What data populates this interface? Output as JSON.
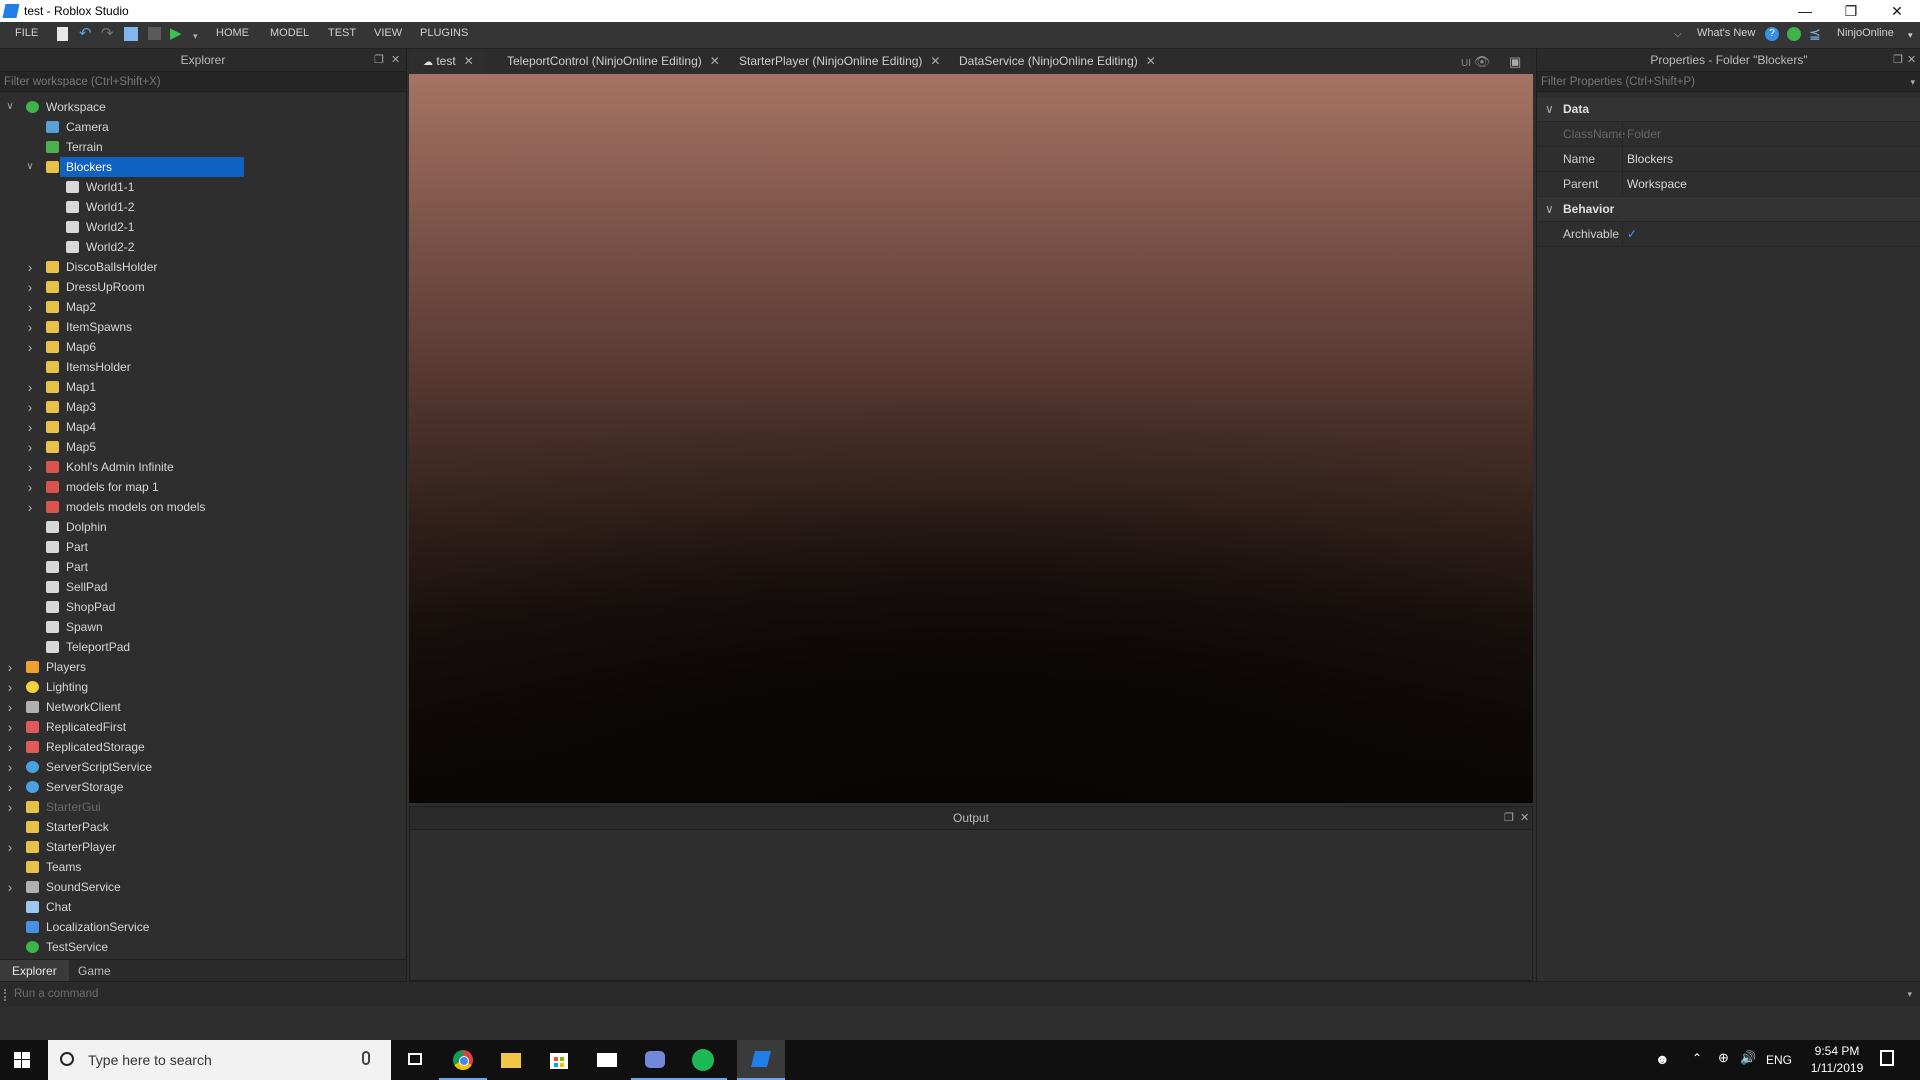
{
  "window": {
    "title": "test - Roblox Studio"
  },
  "menu": [
    "FILE",
    "HOME",
    "MODEL",
    "TEST",
    "VIEW",
    "PLUGINS"
  ],
  "header_right": {
    "whats_new": "What's New",
    "user": "NinjoOnline"
  },
  "explorer": {
    "title": "Explorer",
    "filter_placeholder": "Filter workspace (Ctrl+Shift+X)",
    "rows": [
      {
        "label": "Workspace",
        "depth": 0,
        "chev": "down",
        "icon": "globe",
        "color": "#3db34a"
      },
      {
        "label": "Camera",
        "depth": 1,
        "chev": "",
        "icon": "camera",
        "color": "#5aa0d8"
      },
      {
        "label": "Terrain",
        "depth": 1,
        "chev": "",
        "icon": "terrain",
        "color": "#4caf50"
      },
      {
        "label": "Blockers",
        "depth": 1,
        "chev": "down",
        "icon": "folder",
        "color": "#e8c148",
        "selected": true
      },
      {
        "label": "World1-1",
        "depth": 2,
        "chev": "",
        "icon": "part",
        "color": "#d8d8d8"
      },
      {
        "label": "World1-2",
        "depth": 2,
        "chev": "",
        "icon": "part",
        "color": "#d8d8d8"
      },
      {
        "label": "World2-1",
        "depth": 2,
        "chev": "",
        "icon": "part",
        "color": "#d8d8d8"
      },
      {
        "label": "World2-2",
        "depth": 2,
        "chev": "",
        "icon": "part",
        "color": "#d8d8d8"
      },
      {
        "label": "DiscoBallsHolder",
        "depth": 1,
        "chev": "right",
        "icon": "folder",
        "color": "#e8c148"
      },
      {
        "label": "DressUpRoom",
        "depth": 1,
        "chev": "right",
        "icon": "folder",
        "color": "#e8c148"
      },
      {
        "label": "Map2",
        "depth": 1,
        "chev": "right",
        "icon": "folder",
        "color": "#e8c148"
      },
      {
        "label": "ItemSpawns",
        "depth": 1,
        "chev": "right",
        "icon": "folder",
        "color": "#e8c148"
      },
      {
        "label": "Map6",
        "depth": 1,
        "chev": "right",
        "icon": "folder",
        "color": "#e8c148"
      },
      {
        "label": "ItemsHolder",
        "depth": 1,
        "chev": "",
        "icon": "folder",
        "color": "#e8c148"
      },
      {
        "label": "Map1",
        "depth": 1,
        "chev": "right",
        "icon": "folder",
        "color": "#e8c148"
      },
      {
        "label": "Map3",
        "depth": 1,
        "chev": "right",
        "icon": "folder",
        "color": "#e8c148"
      },
      {
        "label": "Map4",
        "depth": 1,
        "chev": "right",
        "icon": "folder",
        "color": "#e8c148"
      },
      {
        "label": "Map5",
        "depth": 1,
        "chev": "right",
        "icon": "folder",
        "color": "#e8c148"
      },
      {
        "label": "Kohl's Admin Infinite",
        "depth": 1,
        "chev": "right",
        "icon": "model",
        "color": "#d9534f"
      },
      {
        "label": "models for map 1",
        "depth": 1,
        "chev": "right",
        "icon": "model",
        "color": "#d9534f"
      },
      {
        "label": "models models on models",
        "depth": 1,
        "chev": "right",
        "icon": "model",
        "color": "#d9534f"
      },
      {
        "label": "Dolphin",
        "depth": 1,
        "chev": "",
        "icon": "part",
        "color": "#d8d8d8"
      },
      {
        "label": "Part",
        "depth": 1,
        "chev": "",
        "icon": "part",
        "color": "#d8d8d8"
      },
      {
        "label": "Part",
        "depth": 1,
        "chev": "",
        "icon": "part",
        "color": "#d8d8d8"
      },
      {
        "label": "SellPad",
        "depth": 1,
        "chev": "",
        "icon": "part",
        "color": "#d8d8d8"
      },
      {
        "label": "ShopPad",
        "depth": 1,
        "chev": "",
        "icon": "part",
        "color": "#d8d8d8"
      },
      {
        "label": "Spawn",
        "depth": 1,
        "chev": "",
        "icon": "part",
        "color": "#d8d8d8"
      },
      {
        "label": "TeleportPad",
        "depth": 1,
        "chev": "",
        "icon": "part",
        "color": "#d8d8d8"
      },
      {
        "label": "Players",
        "depth": 0,
        "chev": "right",
        "icon": "players",
        "color": "#f0a030"
      },
      {
        "label": "Lighting",
        "depth": 0,
        "chev": "right",
        "icon": "lighting",
        "color": "#f3d23f"
      },
      {
        "label": "NetworkClient",
        "depth": 0,
        "chev": "right",
        "icon": "network",
        "color": "#b0b0b0"
      },
      {
        "label": "ReplicatedFirst",
        "depth": 0,
        "chev": "right",
        "icon": "replicated",
        "color": "#e05a5a"
      },
      {
        "label": "ReplicatedStorage",
        "depth": 0,
        "chev": "right",
        "icon": "replicated",
        "color": "#e05a5a"
      },
      {
        "label": "ServerScriptService",
        "depth": 0,
        "chev": "right",
        "icon": "service",
        "color": "#4aa0e0"
      },
      {
        "label": "ServerStorage",
        "depth": 0,
        "chev": "right",
        "icon": "service",
        "color": "#4aa0e0"
      },
      {
        "label": "StarterGui",
        "depth": 0,
        "chev": "right",
        "icon": "folder",
        "color": "#e8c148",
        "dim": true
      },
      {
        "label": "StarterPack",
        "depth": 0,
        "chev": "",
        "icon": "folder",
        "color": "#e8c148"
      },
      {
        "label": "StarterPlayer",
        "depth": 0,
        "chev": "right",
        "icon": "folder",
        "color": "#e8c148"
      },
      {
        "label": "Teams",
        "depth": 0,
        "chev": "",
        "icon": "folder",
        "color": "#e8c148"
      },
      {
        "label": "SoundService",
        "depth": 0,
        "chev": "right",
        "icon": "sound",
        "color": "#b0b0b0"
      },
      {
        "label": "Chat",
        "depth": 0,
        "chev": "",
        "icon": "chat",
        "color": "#9fc6ef"
      },
      {
        "label": "LocalizationService",
        "depth": 0,
        "chev": "",
        "icon": "localization",
        "color": "#4a90e2"
      },
      {
        "label": "TestService",
        "depth": 0,
        "chev": "",
        "icon": "test",
        "color": "#3db34a"
      }
    ],
    "bottom_tabs": [
      "Explorer",
      "Game"
    ]
  },
  "tabs": [
    {
      "label": "test",
      "active": true
    },
    {
      "label": "TeleportControl (NinjoOnline Editing)"
    },
    {
      "label": "StarterPlayer (NinjoOnline Editing)"
    },
    {
      "label": "DataService (NinjoOnline Editing)"
    }
  ],
  "viewport_ui": "UI",
  "output": {
    "title": "Output"
  },
  "properties": {
    "title": "Properties - Folder \"Blockers\"",
    "filter_placeholder": "Filter Properties (Ctrl+Shift+P)",
    "sections": [
      {
        "name": "Data",
        "props": [
          {
            "key": "ClassName",
            "value": "Folder",
            "dim": true
          },
          {
            "key": "Name",
            "value": "Blockers"
          },
          {
            "key": "Parent",
            "value": "Workspace"
          }
        ]
      },
      {
        "name": "Behavior",
        "props": [
          {
            "key": "Archivable",
            "value": "✓",
            "check": true
          }
        ]
      }
    ]
  },
  "command_bar": {
    "placeholder": "Run a command"
  },
  "taskbar": {
    "search_placeholder": "Type here to search",
    "lang": "ENG",
    "time": "9:54 PM",
    "date": "1/11/2019"
  }
}
